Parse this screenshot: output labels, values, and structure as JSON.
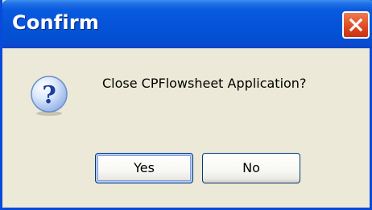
{
  "window": {
    "title": "Confirm",
    "close_icon": "close-icon"
  },
  "message": {
    "icon": "question-icon",
    "text": "Close CPFlowsheet Application?"
  },
  "buttons": {
    "yes_label": "Yes",
    "no_label": "No",
    "default": "yes"
  },
  "colors": {
    "titlebar": "#0553d8",
    "close_button": "#e45a30",
    "dialog_background": "#ece9d8",
    "button_border": "#003c74"
  }
}
